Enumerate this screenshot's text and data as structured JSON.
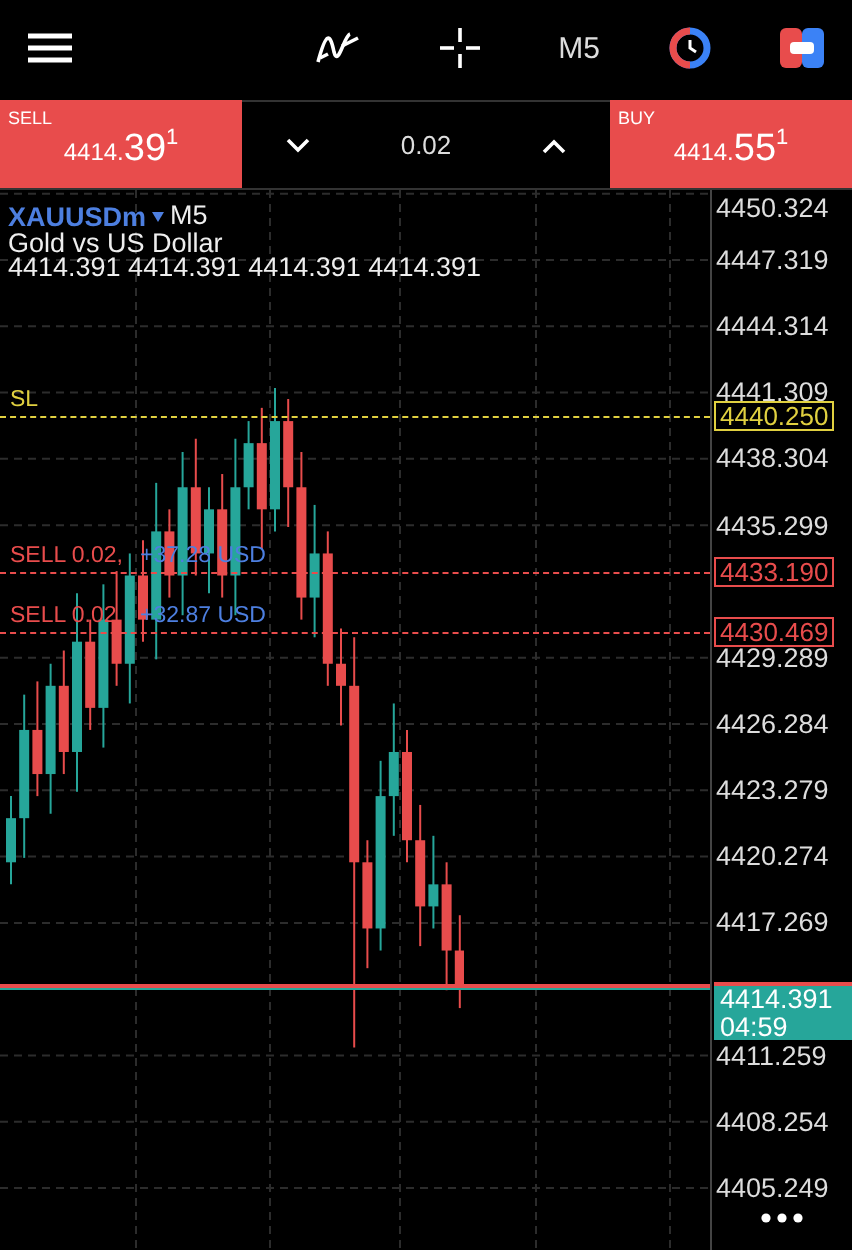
{
  "toolbar": {
    "timeframe": "M5"
  },
  "trade_panel": {
    "sell": {
      "label": "SELL",
      "price_small": "4414.",
      "price_large": "39",
      "price_fraction": "1"
    },
    "volume": "0.02",
    "buy": {
      "label": "BUY",
      "price_small": "4414.",
      "price_large": "55",
      "price_fraction": "1"
    }
  },
  "chart": {
    "symbol": "XAUUSDm",
    "timeframe": "M5",
    "description": "Gold vs US Dollar",
    "ohlc": "4414.391 4414.391 4414.391 4414.391",
    "axis_ticks": [
      "4450.324",
      "4447.319",
      "4444.314",
      "4441.309",
      "4438.304",
      "4435.299",
      "4429.289",
      "4426.284",
      "4423.279",
      "4420.274",
      "4417.269",
      "4411.259",
      "4408.254",
      "4405.249"
    ],
    "levels": [
      {
        "kind": "sl",
        "label": "SL",
        "price": "4440.250"
      },
      {
        "kind": "order",
        "label": "SELL 0.02,",
        "profit": "+37.28 USD",
        "price": "4433.190"
      },
      {
        "kind": "order",
        "label": "SELL 0.02",
        "profit": "+32.87 USD",
        "price": "4430.469"
      }
    ],
    "current": {
      "price": "4414.391",
      "countdown": "04:59"
    }
  }
}
